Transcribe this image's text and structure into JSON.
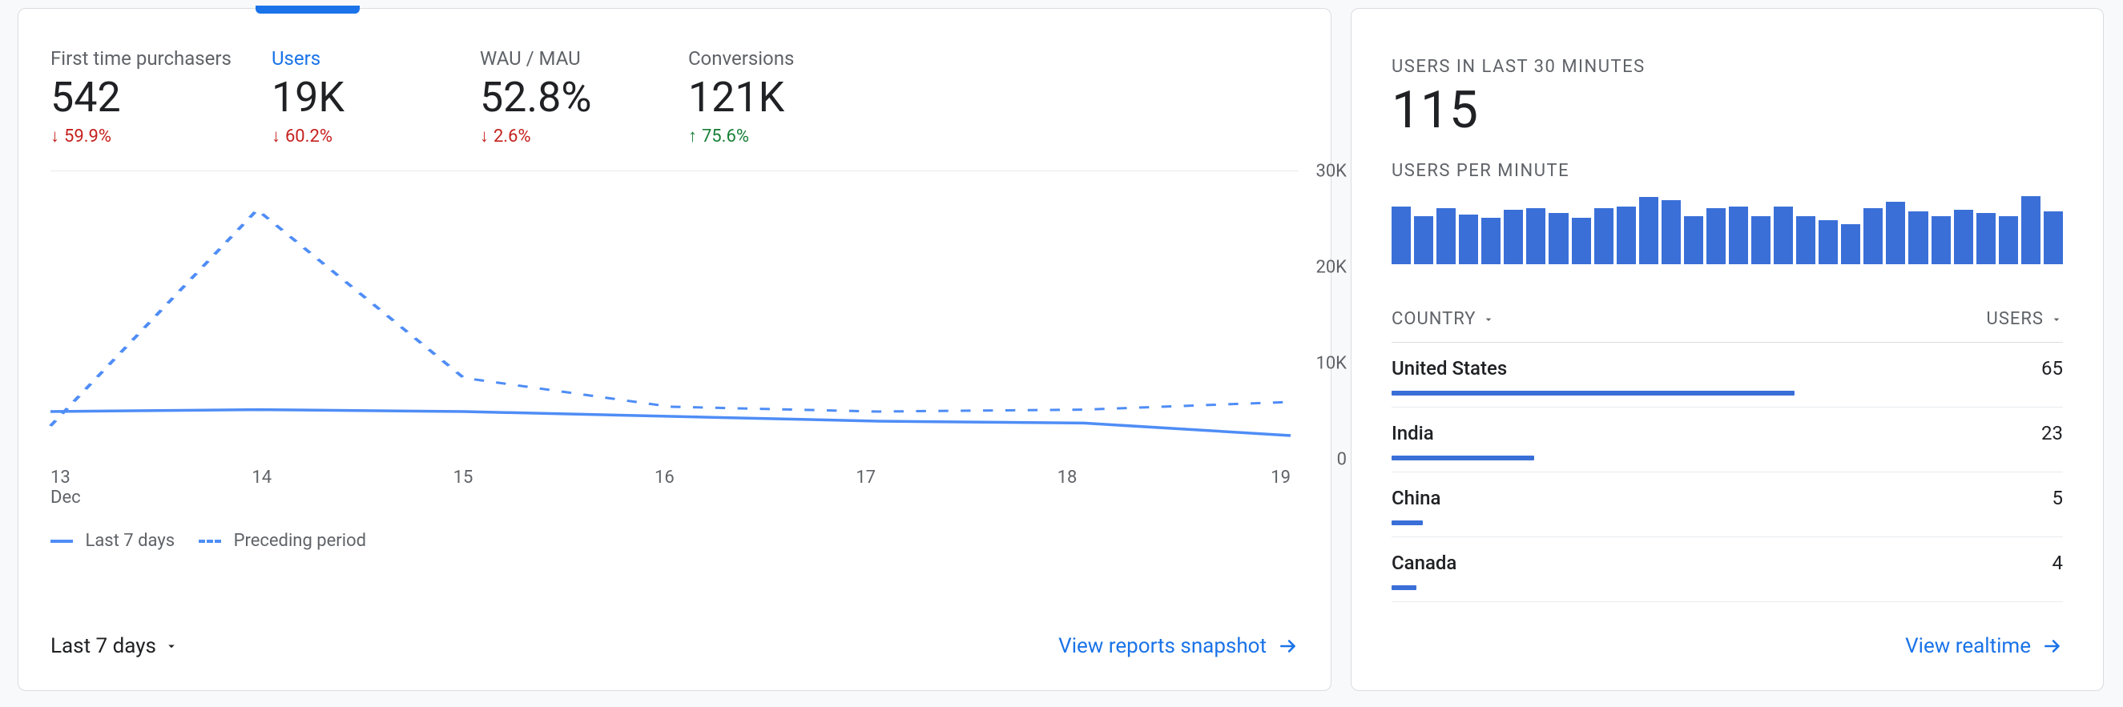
{
  "left": {
    "metrics": [
      {
        "label": "First time purchasers",
        "value": "542",
        "delta": "59.9%",
        "dir": "down",
        "selected": false
      },
      {
        "label": "Users",
        "value": "19K",
        "delta": "60.2%",
        "dir": "down",
        "selected": true
      },
      {
        "label": "WAU / MAU",
        "value": "52.8%",
        "delta": "2.6%",
        "dir": "down",
        "selected": false
      },
      {
        "label": "Conversions",
        "value": "121K",
        "delta": "75.6%",
        "dir": "up",
        "selected": false
      }
    ],
    "legend": {
      "a": "Last 7 days",
      "b": "Preceding period"
    },
    "range_label": "Last 7 days",
    "link_label": "View reports snapshot"
  },
  "right": {
    "title": "USERS IN LAST 30 MINUTES",
    "big": "115",
    "sub2": "USERS PER MINUTE",
    "col_country": "COUNTRY",
    "col_users": "USERS",
    "rows": [
      {
        "name": "United States",
        "value": "65"
      },
      {
        "name": "India",
        "value": "23"
      },
      {
        "name": "China",
        "value": "5"
      },
      {
        "name": "Canada",
        "value": "4"
      }
    ],
    "link_label": "View realtime"
  },
  "chart_data": [
    {
      "type": "line",
      "title": "Users",
      "xlabel": "Dec",
      "ylabel": "",
      "ylim": [
        0,
        30000
      ],
      "yticks": [
        "0",
        "10K",
        "20K",
        "30K"
      ],
      "x": [
        13,
        14,
        15,
        16,
        17,
        18,
        19
      ],
      "series": [
        {
          "name": "Last 7 days",
          "style": "solid",
          "values": [
            5000,
            5200,
            5000,
            4500,
            4000,
            3800,
            2500
          ]
        },
        {
          "name": "Preceding period",
          "style": "dashed",
          "values": [
            3500,
            26000,
            8500,
            5500,
            5000,
            5200,
            6000
          ]
        }
      ]
    },
    {
      "type": "bar",
      "title": "Users per minute",
      "categories": [
        1,
        2,
        3,
        4,
        5,
        6,
        7,
        8,
        9,
        10,
        11,
        12,
        13,
        14,
        15,
        16,
        17,
        18,
        19,
        20,
        21,
        22,
        23,
        24,
        25,
        26,
        27,
        28,
        29,
        30
      ],
      "values": [
        72,
        60,
        70,
        62,
        58,
        68,
        70,
        64,
        58,
        70,
        72,
        84,
        80,
        60,
        70,
        72,
        60,
        72,
        60,
        55,
        50,
        70,
        78,
        66,
        60,
        68,
        64,
        60,
        85,
        66
      ],
      "ylim": [
        0,
        90
      ]
    },
    {
      "type": "table",
      "title": "Users by country (last 30 min)",
      "columns": [
        "Country",
        "Users"
      ],
      "rows": [
        [
          "United States",
          65
        ],
        [
          "India",
          23
        ],
        [
          "China",
          5
        ],
        [
          "Canada",
          4
        ]
      ]
    }
  ]
}
